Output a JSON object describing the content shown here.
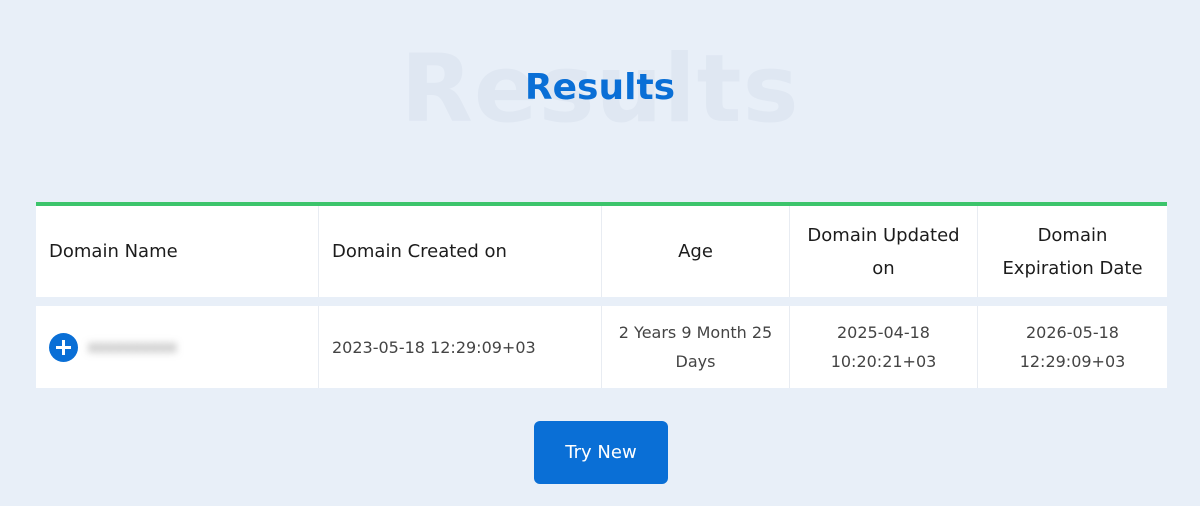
{
  "page": {
    "heading": "Results",
    "heading_background": "Results"
  },
  "table": {
    "headers": [
      "Domain Name",
      "Domain Created on",
      "Age",
      "Domain Updated on",
      "Domain Expiration Date"
    ],
    "rows": [
      {
        "domain_name": "xxxxxxxxxx",
        "created_on": "2023-05-18 12:29:09+03",
        "age": "2 Years 9 Month 25 Days",
        "updated_on": "2025-04-18 10:20:21+03",
        "expiration_date": "2026-05-18 12:29:09+03"
      }
    ]
  },
  "actions": {
    "try_new_label": "Try New"
  },
  "colors": {
    "accent": "#0a6fd6",
    "table_top_border": "#3cc46b",
    "background": "#e8eff8"
  },
  "icons": {
    "expand_row": "plus-icon"
  }
}
